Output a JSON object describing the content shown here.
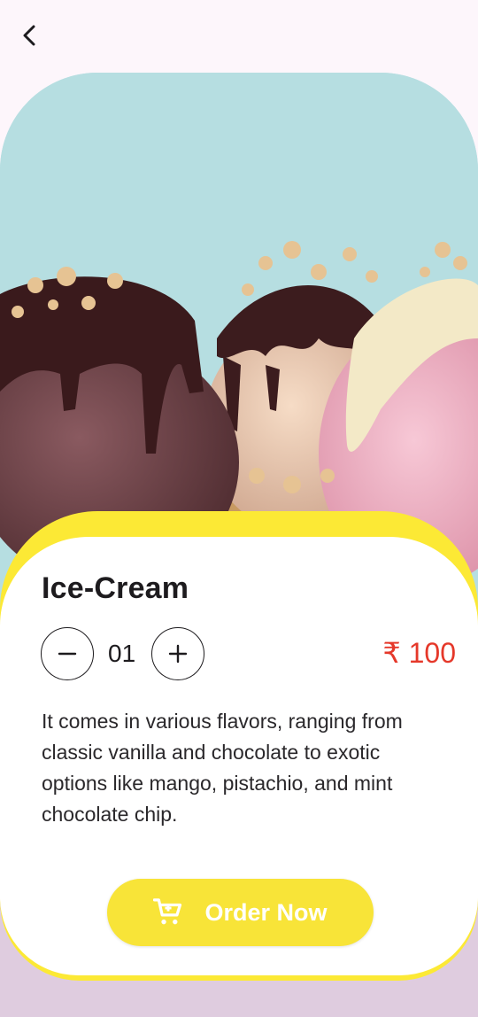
{
  "header": {
    "back_icon": "chevron-left-icon"
  },
  "product": {
    "name": "Ice-Cream",
    "quantity": "01",
    "price": "₹ 100",
    "description": "It comes in various flavors, ranging from classic vanilla and chocolate to exotic options like mango, pistachio, and mint chocolate chip."
  },
  "actions": {
    "minus_icon": "minus-icon",
    "plus_icon": "plus-icon",
    "order_label": "Order Now",
    "cart_icon": "cart-icon"
  },
  "colors": {
    "accent_yellow": "#fce935",
    "price_red": "#e5382a",
    "background": "#fdf6fb"
  }
}
